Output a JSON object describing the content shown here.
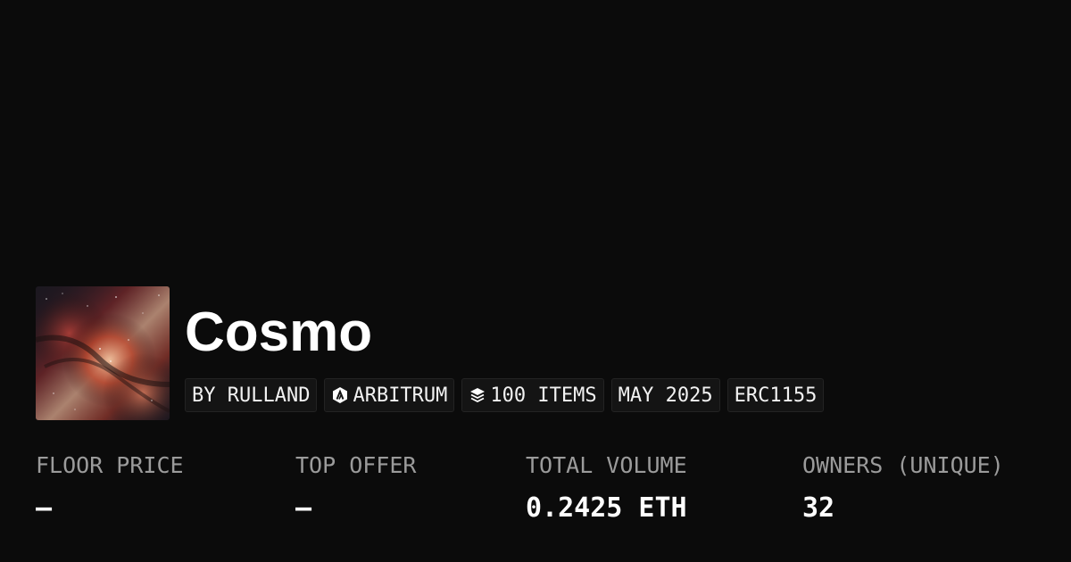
{
  "collection": {
    "name": "Cosmo",
    "tags": {
      "creator": "BY RULLAND",
      "chain": "ARBITRUM",
      "items": "100 ITEMS",
      "date": "MAY 2025",
      "standard": "ERC1155"
    },
    "icons": {
      "chain": "arbitrum-icon",
      "items": "layers-icon",
      "avatar": "milky-way-image"
    }
  },
  "stats": [
    {
      "label": "FLOOR PRICE",
      "value": "–"
    },
    {
      "label": "TOP OFFER",
      "value": "–"
    },
    {
      "label": "TOTAL VOLUME",
      "value": "0.2425 ETH"
    },
    {
      "label": "OWNERS (UNIQUE)",
      "value": "32"
    }
  ],
  "colors": {
    "background": "#0b0b0b",
    "tag_background": "#141414",
    "label": "#9b9b9b",
    "text": "#ffffff"
  }
}
